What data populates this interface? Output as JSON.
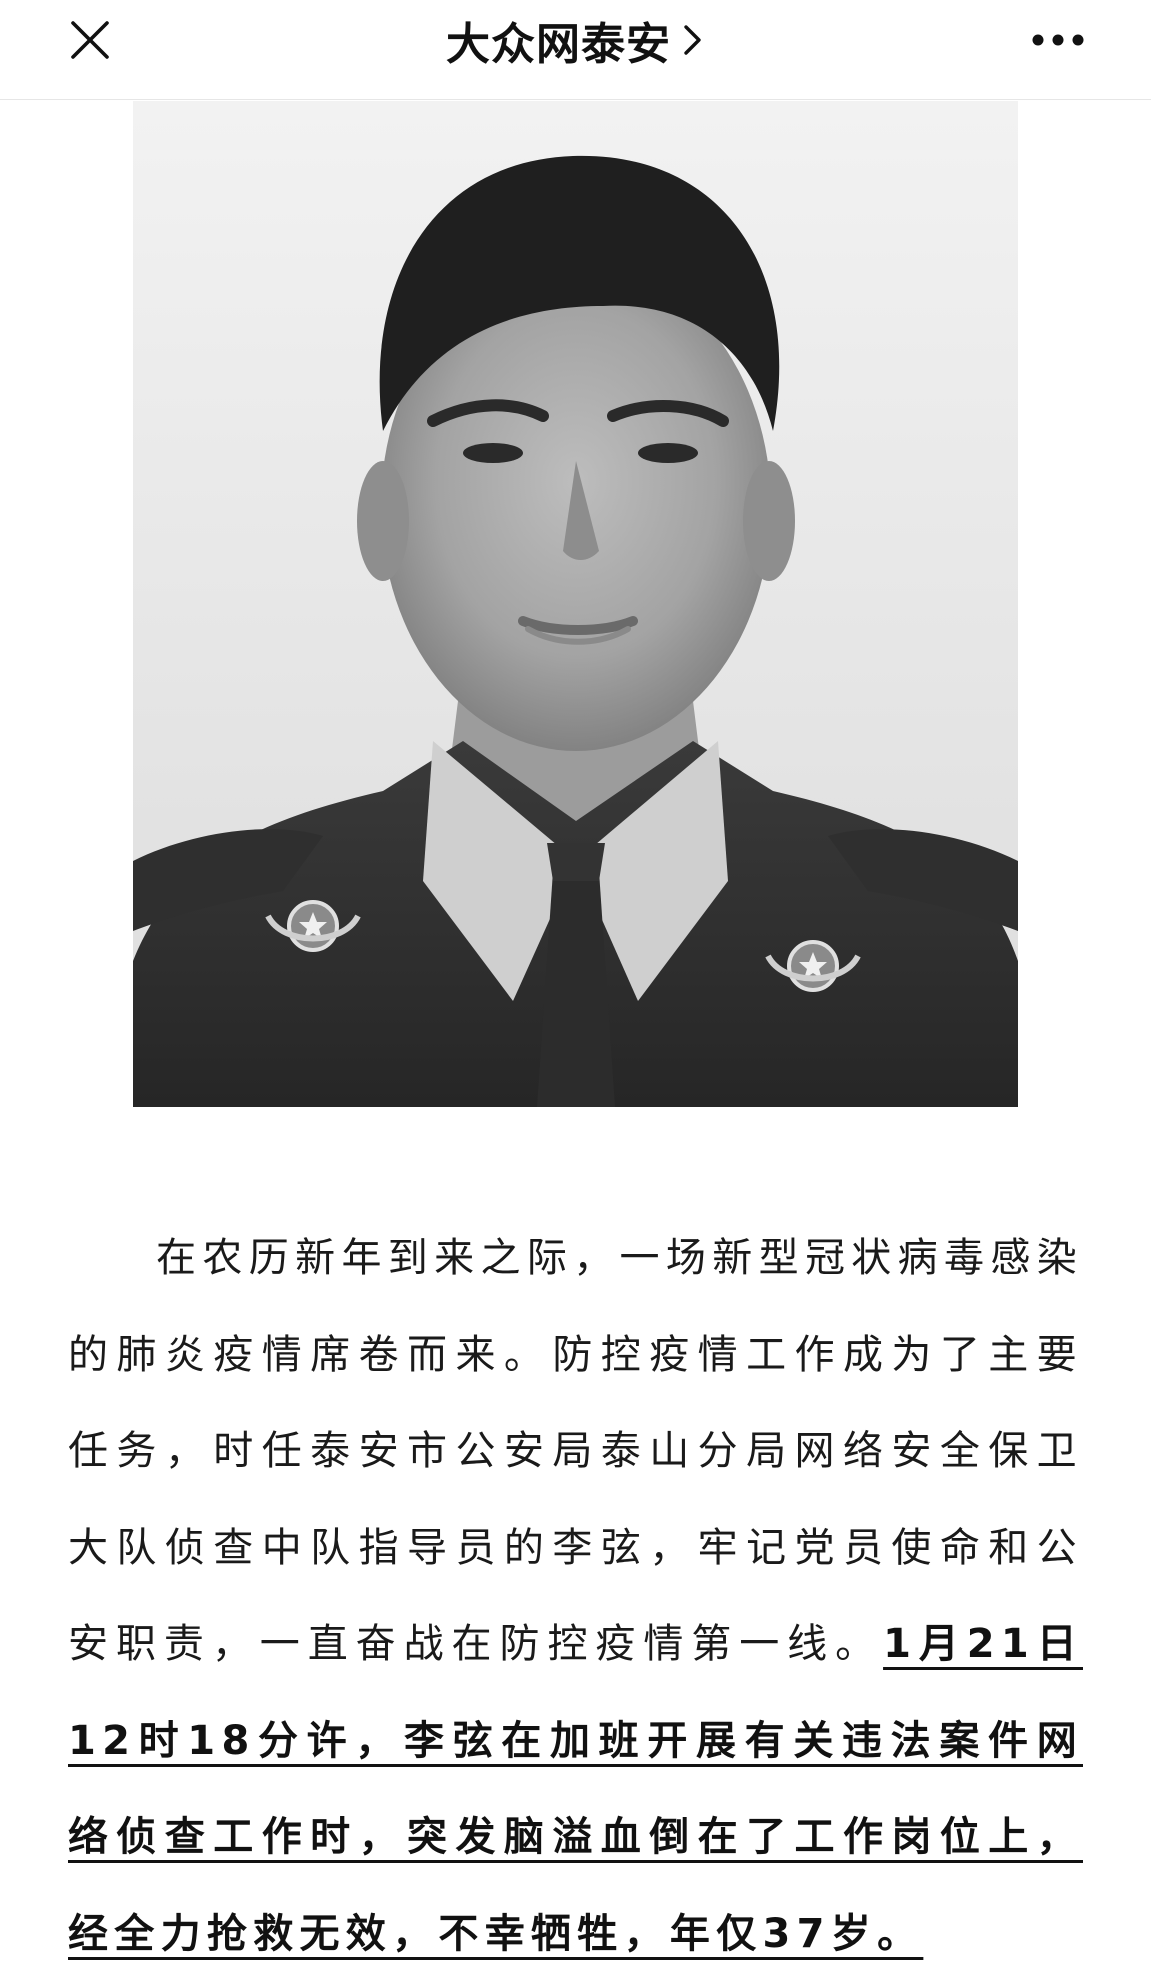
{
  "header": {
    "account_name": "大众网泰安",
    "close_icon": "close-icon",
    "chevron_icon": "chevron-right-icon",
    "more_icon": "more-dots-icon"
  },
  "photo": {
    "subject": "portrait-photo",
    "style": "black-and-white"
  },
  "article": {
    "paragraph_plain": "在农历新年到来之际，一场新型冠状病毒感染的肺炎疫情席卷而来。防控疫情工作成为了主要任务，时任泰安市公安局泰山分局网络安全保卫大队侦查中队指导员的李弦，牢记党员使命和公安职责，一直奋战在防控疫情第一线。",
    "paragraph_emphasis": "1月21日12时18分许，李弦在加班开展有关违法案件网络侦查工作时，突发脑溢血倒在了工作岗位上，经全力抢救无效，不幸牺牲，年仅37岁。"
  }
}
